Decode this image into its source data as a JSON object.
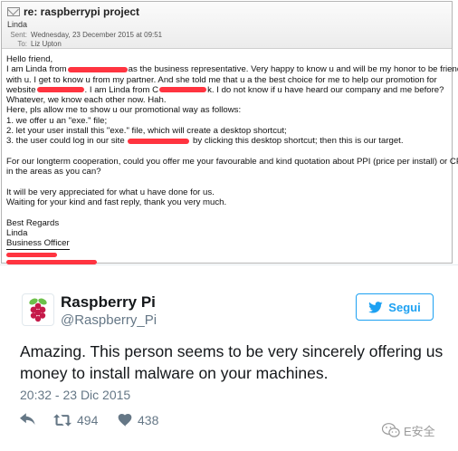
{
  "email": {
    "subject": "re: raspberrypi project",
    "from": "Linda",
    "sent_label": "Sent:",
    "sent_value": "Wednesday, 23 December 2015 at 09:51",
    "to_label": "To:",
    "to_value": "Liz Upton",
    "body": {
      "greeting": "Hello friend,",
      "l1a": "I am Linda from",
      "l1b": "as the business representative. Very happy to know u and will be my honor to be friend",
      "l2": "with u. I get to know u from my partner. And she told me that u a the best choice for me to help our promotion for",
      "l3a": "website",
      "l3b": ". I am Linda from C",
      "l3c": "k. I do not know if u have heard our company and me before?",
      "l4": "Whatever, we know each other now. Hah.",
      "l5": "Here, pls allow me to show u our promotional way as follows:",
      "l6": "1. we offer u an \"exe.\" file;",
      "l7": "2. let your user install this \"exe.\" file, which will create a desktop shortcut;",
      "l8a": "3. the user could log in our site",
      "l8b": "by clicking this desktop shortcut; then this is our target.",
      "p2a": "For our longterm cooperation, could you offer me your favourable and kind quotation about PPI (price per install) or CPI",
      "p2b": "in the areas as you can?",
      "p3a": "It will be very appreciated for what u have done for us.",
      "p3b": "Waiting for your kind and fast reply, thank you very much.",
      "sign1": "Best Regards",
      "sign2": "Linda",
      "sign3": "Business Officer"
    }
  },
  "tweet": {
    "display_name": "Raspberry Pi",
    "handle": "@Raspberry_Pi",
    "follow_label": "Segui",
    "text": "Amazing. This person seems to be very sincerely offering us money to install malware on your machines.",
    "timestamp": "20:32 - 23 Dic 2015",
    "retweets": "494",
    "likes": "438",
    "icons": {
      "reply": "reply-icon",
      "retweet": "retweet-icon",
      "like": "heart-icon",
      "follow": "twitter-bird-icon",
      "avatar": "raspberry-pi-logo"
    },
    "colors": {
      "accent": "#1da1f2",
      "secondary": "#657786",
      "text": "#14171a"
    }
  },
  "watermark": {
    "text": "E安全"
  },
  "colors": {
    "redaction": "#ff3440"
  }
}
